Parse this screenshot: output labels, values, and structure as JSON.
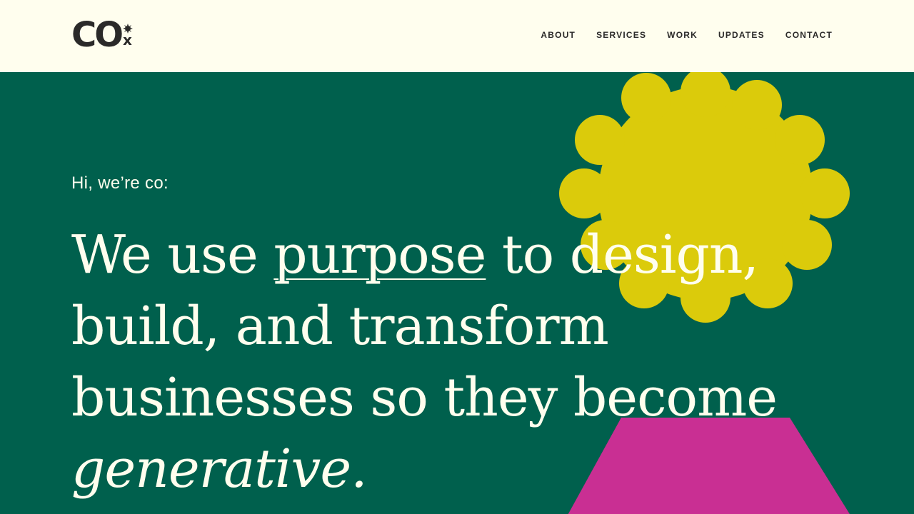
{
  "header": {
    "logo": {
      "text": "CO",
      "mark": "x",
      "icon": "sun-icon"
    },
    "nav": [
      "ABOUT",
      "SERVICES",
      "WORK",
      "UPDATES",
      "CONTACT"
    ]
  },
  "hero": {
    "intro": "Hi, we’re co:",
    "headline": {
      "part1": "We use ",
      "link": "purpose",
      "part2": " to design,",
      "line2": "build, and transform",
      "line3": "businesses so they become",
      "emphasis": "generative."
    }
  },
  "colors": {
    "background": "#fffeee",
    "hero_green": "#00604d",
    "yellow": "#dbcb0b",
    "pink": "#c92f93",
    "text_dark": "#2b2a29"
  }
}
